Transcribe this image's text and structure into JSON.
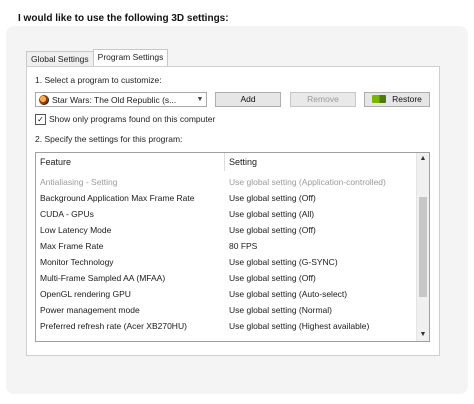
{
  "heading": "I would like to use the following 3D settings:",
  "tabs": [
    {
      "label": "Global Settings",
      "active": false
    },
    {
      "label": "Program Settings",
      "active": true
    }
  ],
  "step1_label": "1. Select a program to customize:",
  "program_select": {
    "value": "Star Wars: The Old Republic (s..."
  },
  "buttons": {
    "add": "Add",
    "remove": "Remove",
    "restore": "Restore"
  },
  "show_only_checkbox": {
    "label": "Show only programs found on this computer",
    "checked": true,
    "mark": "✓"
  },
  "step2_label": "2. Specify the settings for this program:",
  "table": {
    "columns": [
      "Feature",
      "Setting"
    ],
    "rows": [
      {
        "feature": "Antialiasing - Setting",
        "setting": "Use global setting (Application-controlled)",
        "muted": true
      },
      {
        "feature": "Background Application Max Frame Rate",
        "setting": "Use global setting (Off)"
      },
      {
        "feature": "CUDA - GPUs",
        "setting": "Use global setting (All)"
      },
      {
        "feature": "Low Latency Mode",
        "setting": "Use global setting (Off)"
      },
      {
        "feature": "Max Frame Rate",
        "setting": "80 FPS"
      },
      {
        "feature": "Monitor Technology",
        "setting": "Use global setting (G-SYNC)"
      },
      {
        "feature": "Multi-Frame Sampled AA (MFAA)",
        "setting": "Use global setting (Off)"
      },
      {
        "feature": "OpenGL rendering GPU",
        "setting": "Use global setting (Auto-select)"
      },
      {
        "feature": "Power management mode",
        "setting": "Use global setting (Normal)"
      },
      {
        "feature": "Preferred refresh rate (Acer XB270HU)",
        "setting": "Use global setting (Highest available)"
      }
    ]
  },
  "icons": {
    "dropdown": "chevron-down-icon",
    "game": "game-icon",
    "nvidia": "nvidia-logo-icon"
  },
  "colors": {
    "nvidia_green": "#76b900",
    "muted_text": "#9b9b9b"
  }
}
